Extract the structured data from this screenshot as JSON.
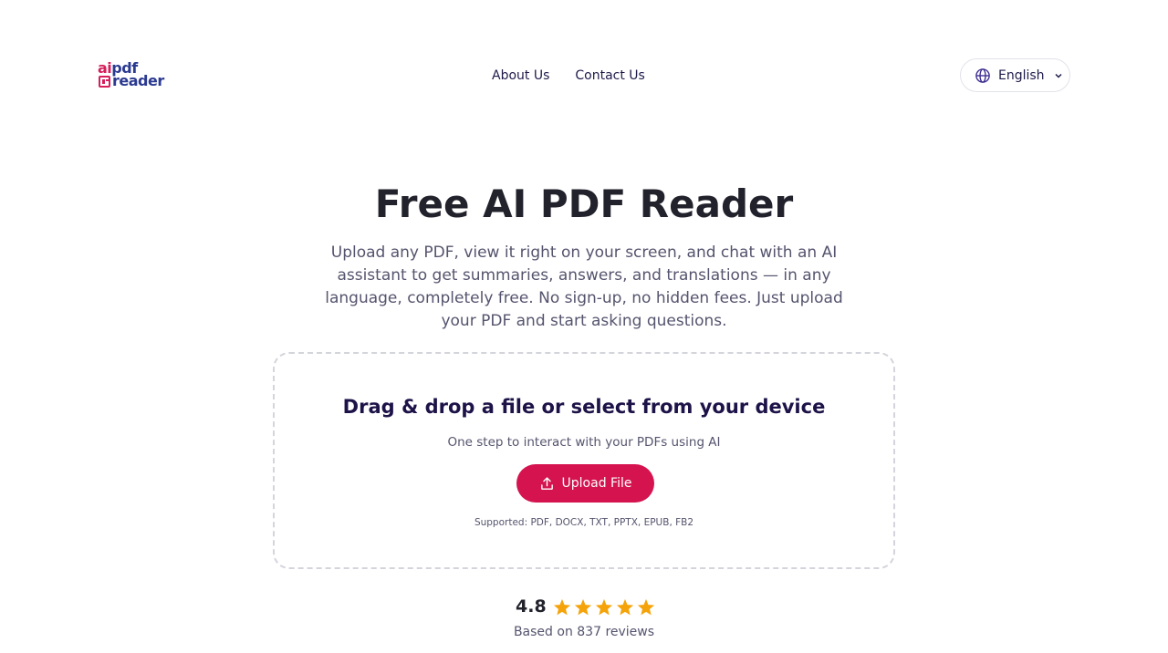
{
  "brand": {
    "logo_line1_a": "ai",
    "logo_line1_b": "pdf",
    "logo_line2": "reader",
    "colors": {
      "accent": "#d4134f",
      "brand_blue": "#2b3a91",
      "star": "#f5a30a"
    }
  },
  "nav": {
    "items": [
      {
        "label": "About Us"
      },
      {
        "label": "Contact Us"
      }
    ]
  },
  "language": {
    "selected": "English",
    "icon": "globe-icon"
  },
  "hero": {
    "title": "Free AI PDF Reader",
    "subtitle": "Upload any PDF, view it right on your screen, and chat with an AI assistant to get summaries, answers, and translations — in any language, completely free. No sign-up, no hidden fees. Just upload your PDF and start asking questions."
  },
  "upload": {
    "title": "Drag & drop a file or select from your device",
    "subtitle": "One step to interact with your PDFs using AI",
    "button_label": "Upload File",
    "button_icon": "upload-icon",
    "supported": "Supported: PDF, DOCX, TXT, PPTX, EPUB, FB2"
  },
  "rating": {
    "value": "4.8",
    "stars_filled": 5,
    "stars_total": 5,
    "reviews_text": "Based on 837 reviews"
  }
}
